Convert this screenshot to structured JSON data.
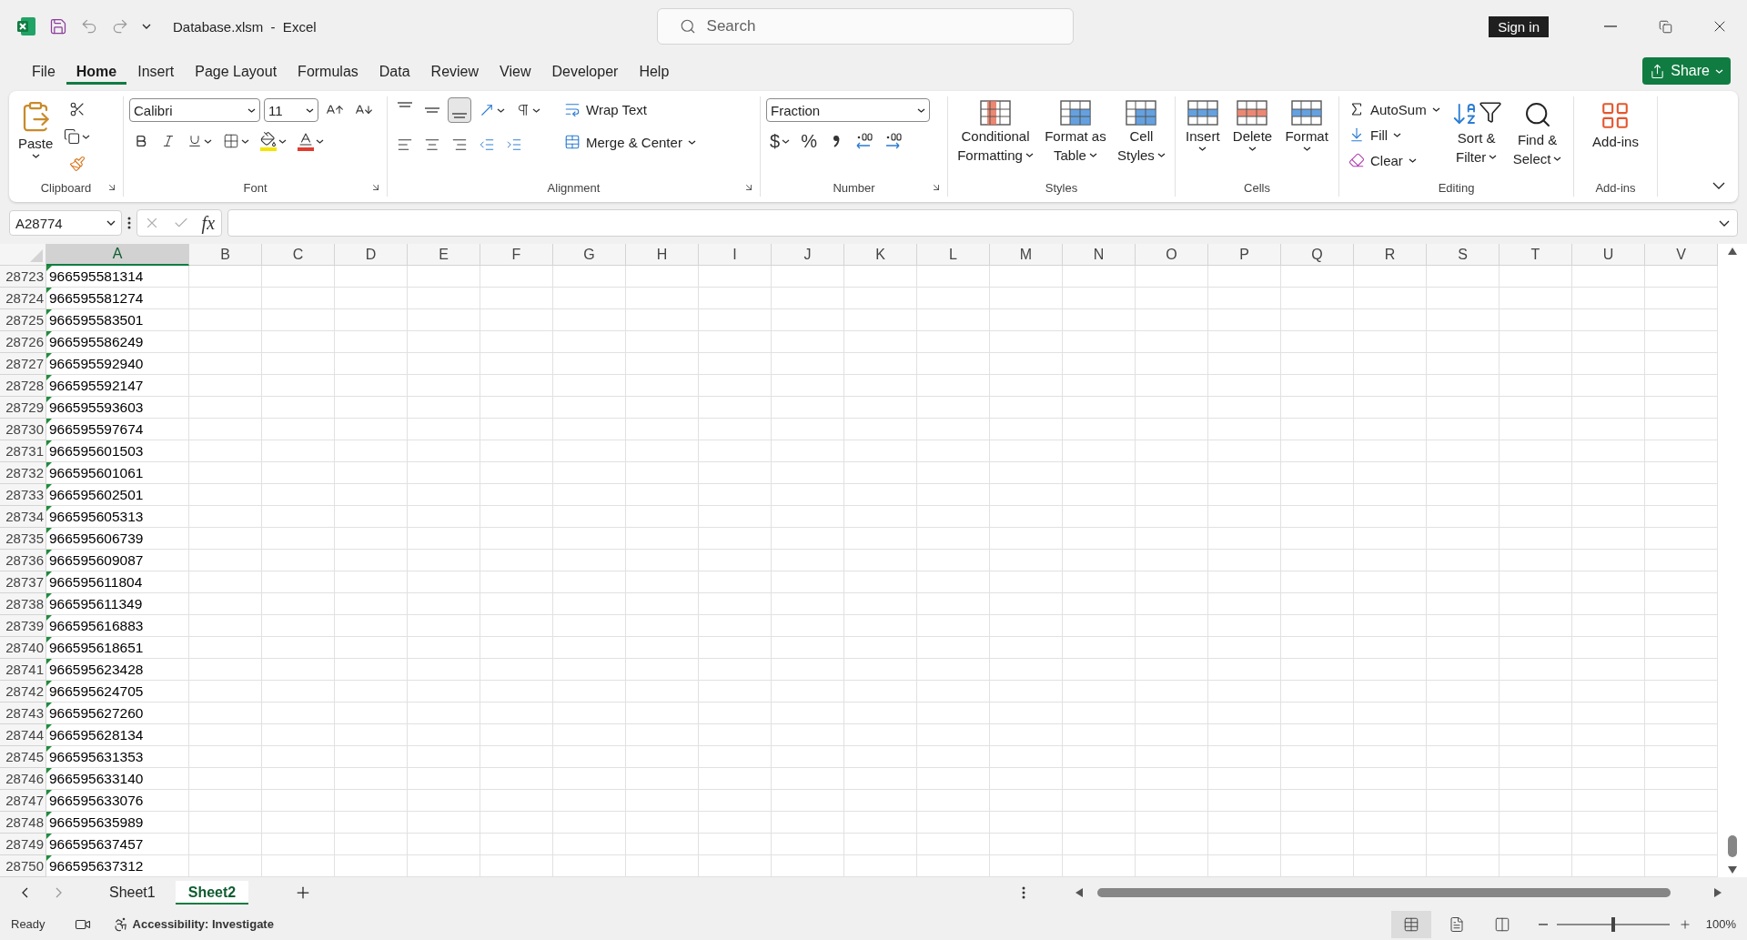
{
  "title_bar": {
    "file_title": "Database.xlsm  -  Excel",
    "search_placeholder": "Search",
    "sign_in": "Sign in"
  },
  "menu_tabs": [
    {
      "label": "File",
      "selected": false
    },
    {
      "label": "Home",
      "selected": true
    },
    {
      "label": "Insert",
      "selected": false
    },
    {
      "label": "Page Layout",
      "selected": false
    },
    {
      "label": "Formulas",
      "selected": false
    },
    {
      "label": "Data",
      "selected": false
    },
    {
      "label": "Review",
      "selected": false
    },
    {
      "label": "View",
      "selected": false
    },
    {
      "label": "Developer",
      "selected": false
    },
    {
      "label": "Help",
      "selected": false
    }
  ],
  "share": "Share",
  "ribbon": {
    "clipboard": {
      "paste": "Paste",
      "label": "Clipboard"
    },
    "font": {
      "name": "Calibri",
      "size": "11",
      "label": "Font"
    },
    "alignment": {
      "vertical": [
        {
          "kind": "top",
          "selected": false
        },
        {
          "kind": "middle",
          "selected": false
        },
        {
          "kind": "bottom",
          "selected": true
        }
      ],
      "wrap": "Wrap Text",
      "merge": "Merge & Center",
      "label": "Alignment"
    },
    "number": {
      "format": "Fraction",
      "currency": "$",
      "percent": "%",
      "label": "Number"
    },
    "styles": {
      "label": "Styles",
      "buttons": [
        {
          "kind": "conditional",
          "lines": [
            "Conditional",
            "Formatting"
          ]
        },
        {
          "kind": "table",
          "lines": [
            "Format as",
            "Table"
          ]
        },
        {
          "kind": "cellstyles",
          "lines": [
            "Cell",
            "Styles"
          ]
        }
      ]
    },
    "cells": {
      "label": "Cells",
      "buttons": [
        {
          "kind": "insert",
          "lines": [
            "Insert"
          ]
        },
        {
          "kind": "delete",
          "lines": [
            "Delete"
          ]
        },
        {
          "kind": "format",
          "lines": [
            "Format"
          ]
        }
      ]
    },
    "editing": {
      "label": "Editing",
      "small": [
        {
          "kind": "autosum",
          "text": "AutoSum"
        },
        {
          "kind": "fill",
          "text": "Fill"
        },
        {
          "kind": "clear",
          "text": "Clear"
        }
      ],
      "buttons": [
        {
          "kind": "sort",
          "lines": [
            "Sort &",
            "Filter"
          ]
        },
        {
          "kind": "find",
          "lines": [
            "Find &",
            "Select"
          ]
        }
      ]
    },
    "addins": {
      "label": "Add-ins",
      "buttons": [
        {
          "kind": "addins",
          "lines": [
            "Add-ins"
          ]
        }
      ]
    }
  },
  "formula_bar": {
    "name_box": "A28774",
    "function_symbol": "fx"
  },
  "columns": [
    {
      "letter": "A",
      "selected": true
    },
    {
      "letter": "B",
      "selected": false
    },
    {
      "letter": "C",
      "selected": false
    },
    {
      "letter": "D",
      "selected": false
    },
    {
      "letter": "E",
      "selected": false
    },
    {
      "letter": "F",
      "selected": false
    },
    {
      "letter": "G",
      "selected": false
    },
    {
      "letter": "H",
      "selected": false
    },
    {
      "letter": "I",
      "selected": false
    },
    {
      "letter": "J",
      "selected": false
    },
    {
      "letter": "K",
      "selected": false
    },
    {
      "letter": "L",
      "selected": false
    },
    {
      "letter": "M",
      "selected": false
    },
    {
      "letter": "N",
      "selected": false
    },
    {
      "letter": "O",
      "selected": false
    },
    {
      "letter": "P",
      "selected": false
    },
    {
      "letter": "Q",
      "selected": false
    },
    {
      "letter": "R",
      "selected": false
    },
    {
      "letter": "S",
      "selected": false
    },
    {
      "letter": "T",
      "selected": false
    },
    {
      "letter": "U",
      "selected": false
    },
    {
      "letter": "V",
      "selected": false
    }
  ],
  "rows": [
    {
      "number": "28723",
      "value": "966595581314",
      "flagged": true
    },
    {
      "number": "28724",
      "value": "966595581274",
      "flagged": true
    },
    {
      "number": "28725",
      "value": "966595583501",
      "flagged": true
    },
    {
      "number": "28726",
      "value": "966595586249",
      "flagged": true
    },
    {
      "number": "28727",
      "value": "966595592940",
      "flagged": true
    },
    {
      "number": "28728",
      "value": "966595592147",
      "flagged": true
    },
    {
      "number": "28729",
      "value": "966595593603",
      "flagged": true
    },
    {
      "number": "28730",
      "value": "966595597674",
      "flagged": true
    },
    {
      "number": "28731",
      "value": "966595601503",
      "flagged": true
    },
    {
      "number": "28732",
      "value": "966595601061",
      "flagged": true
    },
    {
      "number": "28733",
      "value": "966595602501",
      "flagged": true
    },
    {
      "number": "28734",
      "value": "966595605313",
      "flagged": true
    },
    {
      "number": "28735",
      "value": "966595606739",
      "flagged": true
    },
    {
      "number": "28736",
      "value": "966595609087",
      "flagged": true
    },
    {
      "number": "28737",
      "value": "966595611804",
      "flagged": true
    },
    {
      "number": "28738",
      "value": "966595611349",
      "flagged": true
    },
    {
      "number": "28739",
      "value": "966595616883",
      "flagged": true
    },
    {
      "number": "28740",
      "value": "966595618651",
      "flagged": true
    },
    {
      "number": "28741",
      "value": "966595623428",
      "flagged": true
    },
    {
      "number": "28742",
      "value": "966595624705",
      "flagged": true
    },
    {
      "number": "28743",
      "value": "966595627260",
      "flagged": true
    },
    {
      "number": "28744",
      "value": "966595628134",
      "flagged": true
    },
    {
      "number": "28745",
      "value": "966595631353",
      "flagged": true
    },
    {
      "number": "28746",
      "value": "966595633140",
      "flagged": true
    },
    {
      "number": "28747",
      "value": "966595633076",
      "flagged": true
    },
    {
      "number": "28748",
      "value": "966595635989",
      "flagged": true
    },
    {
      "number": "28749",
      "value": "966595637457",
      "flagged": true
    },
    {
      "number": "28750",
      "value": "966595637312",
      "flagged": true
    }
  ],
  "sheets": [
    {
      "name": "Sheet1",
      "selected": false
    },
    {
      "name": "Sheet2",
      "selected": true
    }
  ],
  "status_bar": {
    "ready": "Ready",
    "accessibility": "Accessibility: Investigate",
    "views": [
      {
        "kind": "normal",
        "selected": true
      },
      {
        "kind": "layout",
        "selected": false
      },
      {
        "kind": "break",
        "selected": false
      }
    ],
    "zoom": {
      "level": 0.5,
      "reading": "100%"
    }
  }
}
